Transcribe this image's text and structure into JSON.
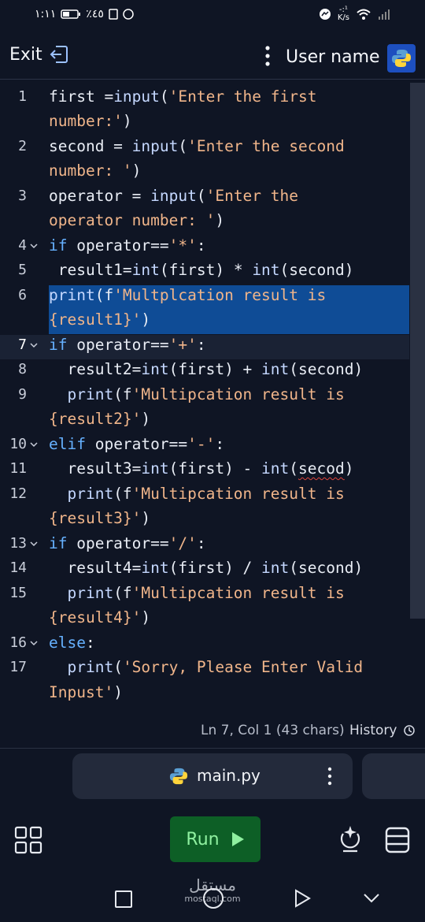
{
  "status_bar": {
    "time": "١:١١",
    "battery": "٪٤٥",
    "speed_top": "-:¹",
    "speed_unit": "K/s"
  },
  "header": {
    "exit_label": "Exit",
    "user_name": "User name",
    "icons": [
      "exit-icon",
      "more-vertical-icon",
      "python-logo-icon"
    ]
  },
  "editor": {
    "cursor_line": 7,
    "selected_line": 6,
    "lines": [
      {
        "n": "1",
        "text": "first =input('Enter the first"
      },
      {
        "n": "",
        "text": "number:')"
      },
      {
        "n": "2",
        "text": "second = input('Enter the second"
      },
      {
        "n": "",
        "text": "number: ')"
      },
      {
        "n": "3",
        "text": "operator = input('Enter the"
      },
      {
        "n": "",
        "text": "operator number: ')"
      },
      {
        "n": "4",
        "text": "if operator=='*':"
      },
      {
        "n": "5",
        "text": " result1=int(first) * int(second)"
      },
      {
        "n": "6",
        "text": "print(f'Multplcation result is"
      },
      {
        "n": "",
        "text": "{result1}')"
      },
      {
        "n": "7",
        "text": "if operator=='+':"
      },
      {
        "n": "8",
        "text": "  result2=int(first) + int(second)"
      },
      {
        "n": "9",
        "text": "  print(f'Multipcation result is"
      },
      {
        "n": "",
        "text": "{result2}')"
      },
      {
        "n": "10",
        "text": "elif operator=='-':"
      },
      {
        "n": "11",
        "text": "  result3=int(first) - int(secod)"
      },
      {
        "n": "12",
        "text": "  print(f'Multipcation result is"
      },
      {
        "n": "",
        "text": "{result3}')"
      },
      {
        "n": "13",
        "text": "if operator=='/':"
      },
      {
        "n": "14",
        "text": "  result4=int(first) / int(second)"
      },
      {
        "n": "15",
        "text": "  print(f'Multipcation result is"
      },
      {
        "n": "",
        "text": "{result4}')"
      },
      {
        "n": "16",
        "text": "else:"
      },
      {
        "n": "17",
        "text": "  print('Sorry, Please Enter Valid"
      },
      {
        "n": "",
        "text": "Inpust')"
      }
    ]
  },
  "status_line": {
    "position": "Ln 7, Col 1 (43 chars)",
    "history_label": "History"
  },
  "file_tab": {
    "name": "main.py"
  },
  "toolbar": {
    "run_label": "Run"
  },
  "watermark": {
    "text": "مستقل",
    "domain": "mostaql.com"
  },
  "colors": {
    "background": "#0f1524",
    "selection": "#0f4c96",
    "run_button": "#0d5f26",
    "keyword": "#66b1ff",
    "string": "#f0b58a"
  }
}
